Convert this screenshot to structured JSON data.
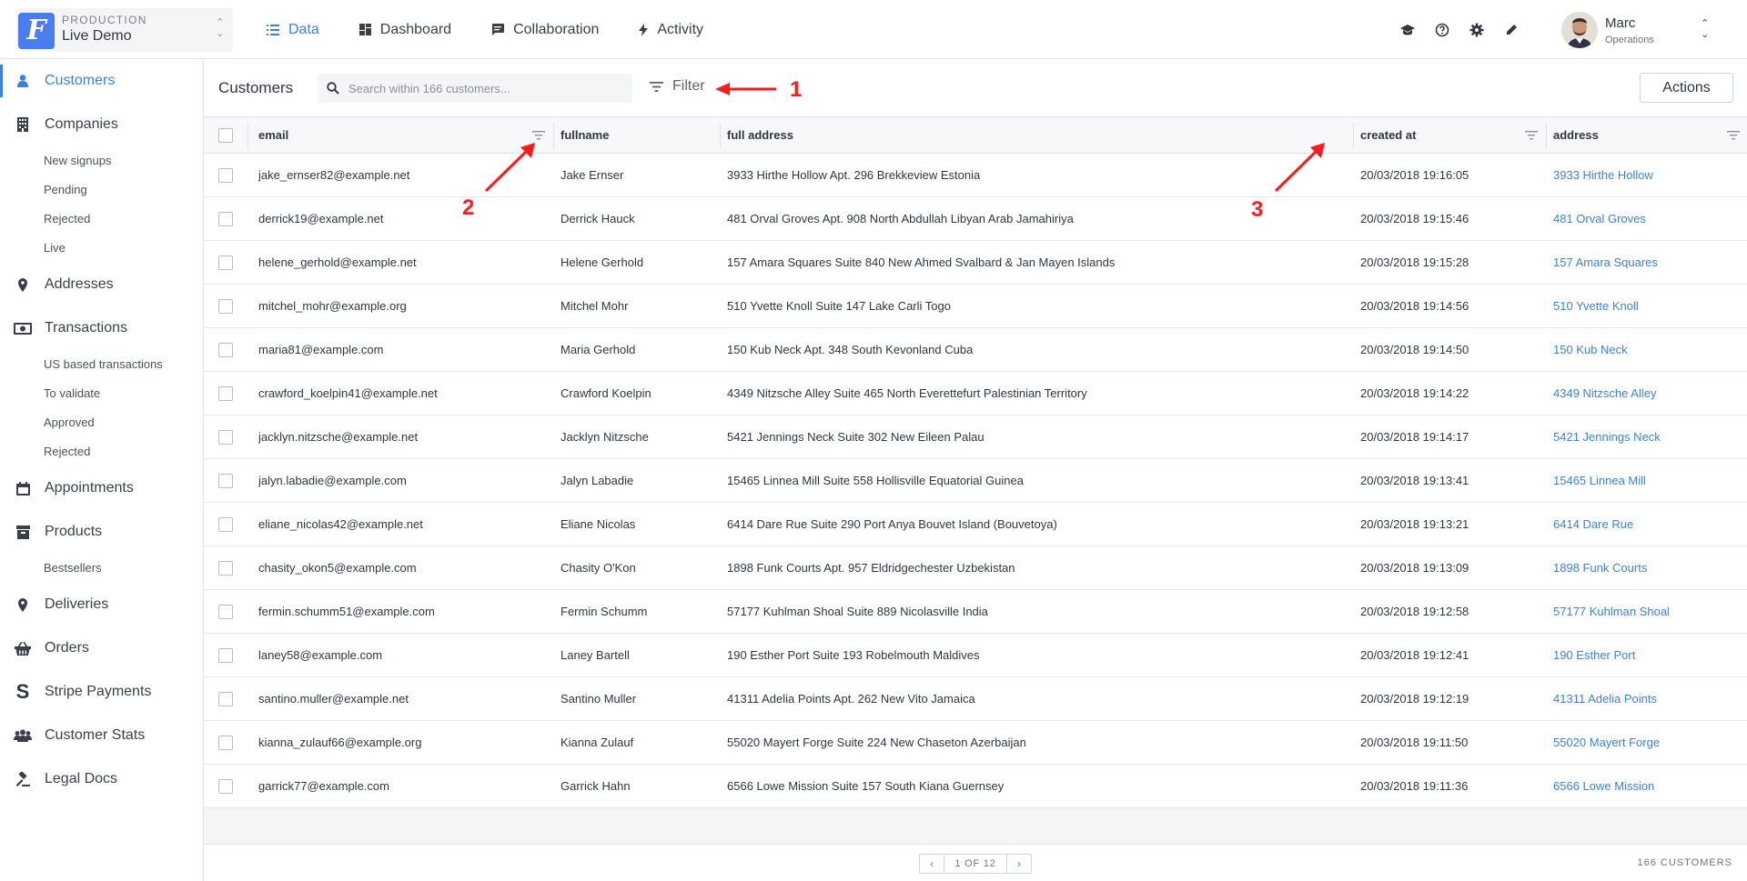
{
  "project": {
    "env": "PRODUCTION",
    "name": "Live Demo",
    "logo": "F"
  },
  "nav": [
    {
      "label": "Data",
      "icon": "list-icon",
      "active": true
    },
    {
      "label": "Dashboard",
      "icon": "dashboard-icon"
    },
    {
      "label": "Collaboration",
      "icon": "chat-icon"
    },
    {
      "label": "Activity",
      "icon": "bolt-icon"
    }
  ],
  "top_icons": [
    "graduation-cap-icon",
    "help-icon",
    "gear-icon",
    "pencil-icon"
  ],
  "user": {
    "name": "Marc",
    "role": "Operations"
  },
  "sidebar": {
    "customers": "Customers",
    "companies": "Companies",
    "new_signups": "New signups",
    "pending": "Pending",
    "rejected1": "Rejected",
    "live": "Live",
    "addresses": "Addresses",
    "transactions": "Transactions",
    "us_tx": "US based transactions",
    "to_validate": "To validate",
    "approved": "Approved",
    "rejected2": "Rejected",
    "appointments": "Appointments",
    "products": "Products",
    "bestsellers": "Bestsellers",
    "deliveries": "Deliveries",
    "orders": "Orders",
    "stripe": "Stripe Payments",
    "customer_stats": "Customer Stats",
    "legal_docs": "Legal Docs"
  },
  "toolbar": {
    "title": "Customers",
    "search_placeholder": "Search within 166 customers...",
    "filter_label": "Filter",
    "actions_label": "Actions"
  },
  "columns": {
    "email": "email",
    "fullname": "fullname",
    "full_address": "full address",
    "created_at": "created at",
    "address": "address"
  },
  "rows": [
    {
      "email": "jake_ernser82@example.net",
      "fullname": "Jake Ernser",
      "full_address": "3933 Hirthe Hollow Apt. 296 Brekkeview Estonia",
      "created_at": "20/03/2018 19:16:05",
      "address": "3933 Hirthe Hollow"
    },
    {
      "email": "derrick19@example.net",
      "fullname": "Derrick Hauck",
      "full_address": "481 Orval Groves Apt. 908 North Abdullah Libyan Arab Jamahiriya",
      "created_at": "20/03/2018 19:15:46",
      "address": "481 Orval Groves"
    },
    {
      "email": "helene_gerhold@example.net",
      "fullname": "Helene Gerhold",
      "full_address": "157 Amara Squares Suite 840 New Ahmed Svalbard & Jan Mayen Islands",
      "created_at": "20/03/2018 19:15:28",
      "address": "157 Amara Squares"
    },
    {
      "email": "mitchel_mohr@example.org",
      "fullname": "Mitchel Mohr",
      "full_address": "510 Yvette Knoll Suite 147 Lake Carli Togo",
      "created_at": "20/03/2018 19:14:56",
      "address": "510 Yvette Knoll"
    },
    {
      "email": "maria81@example.com",
      "fullname": "Maria Gerhold",
      "full_address": "150 Kub Neck Apt. 348 South Kevonland Cuba",
      "created_at": "20/03/2018 19:14:50",
      "address": "150 Kub Neck"
    },
    {
      "email": "crawford_koelpin41@example.net",
      "fullname": "Crawford Koelpin",
      "full_address": "4349 Nitzsche Alley Suite 465 North Everettefurt Palestinian Territory",
      "created_at": "20/03/2018 19:14:22",
      "address": "4349 Nitzsche Alley"
    },
    {
      "email": "jacklyn.nitzsche@example.net",
      "fullname": "Jacklyn Nitzsche",
      "full_address": "5421 Jennings Neck Suite 302 New Eileen Palau",
      "created_at": "20/03/2018 19:14:17",
      "address": "5421 Jennings Neck"
    },
    {
      "email": "jalyn.labadie@example.com",
      "fullname": "Jalyn Labadie",
      "full_address": "15465 Linnea Mill Suite 558 Hollisville Equatorial Guinea",
      "created_at": "20/03/2018 19:13:41",
      "address": "15465 Linnea Mill"
    },
    {
      "email": "eliane_nicolas42@example.net",
      "fullname": "Eliane Nicolas",
      "full_address": "6414 Dare Rue Suite 290 Port Anya Bouvet Island (Bouvetoya)",
      "created_at": "20/03/2018 19:13:21",
      "address": "6414 Dare Rue"
    },
    {
      "email": "chasity_okon5@example.com",
      "fullname": "Chasity O'Kon",
      "full_address": "1898 Funk Courts Apt. 957 Eldridgechester Uzbekistan",
      "created_at": "20/03/2018 19:13:09",
      "address": "1898 Funk Courts"
    },
    {
      "email": "fermin.schumm51@example.com",
      "fullname": "Fermin Schumm",
      "full_address": "57177 Kuhlman Shoal Suite 889 Nicolasville India",
      "created_at": "20/03/2018 19:12:58",
      "address": "57177 Kuhlman Shoal"
    },
    {
      "email": "laney58@example.com",
      "fullname": "Laney Bartell",
      "full_address": "190 Esther Port Suite 193 Robelmouth Maldives",
      "created_at": "20/03/2018 19:12:41",
      "address": "190 Esther Port"
    },
    {
      "email": "santino.muller@example.net",
      "fullname": "Santino Muller",
      "full_address": "41311 Adelia Points Apt. 262 New Vito Jamaica",
      "created_at": "20/03/2018 19:12:19",
      "address": "41311 Adelia Points"
    },
    {
      "email": "kianna_zulauf66@example.org",
      "fullname": "Kianna Zulauf",
      "full_address": "55020 Mayert Forge Suite 224 New Chaseton Azerbaijan",
      "created_at": "20/03/2018 19:11:50",
      "address": "55020 Mayert Forge"
    },
    {
      "email": "garrick77@example.com",
      "fullname": "Garrick Hahn",
      "full_address": "6566 Lowe Mission Suite 157 South Kiana Guernsey",
      "created_at": "20/03/2018 19:11:36",
      "address": "6566 Lowe Mission"
    }
  ],
  "pagination": {
    "label": "1 OF 12",
    "total": "166 CUSTOMERS"
  },
  "annotations": {
    "a1": "1",
    "a2": "2",
    "a3": "3"
  },
  "colors": {
    "accent": "#3b82e0",
    "annotation": "#ff1a1a",
    "logo": "#4a7df2"
  }
}
